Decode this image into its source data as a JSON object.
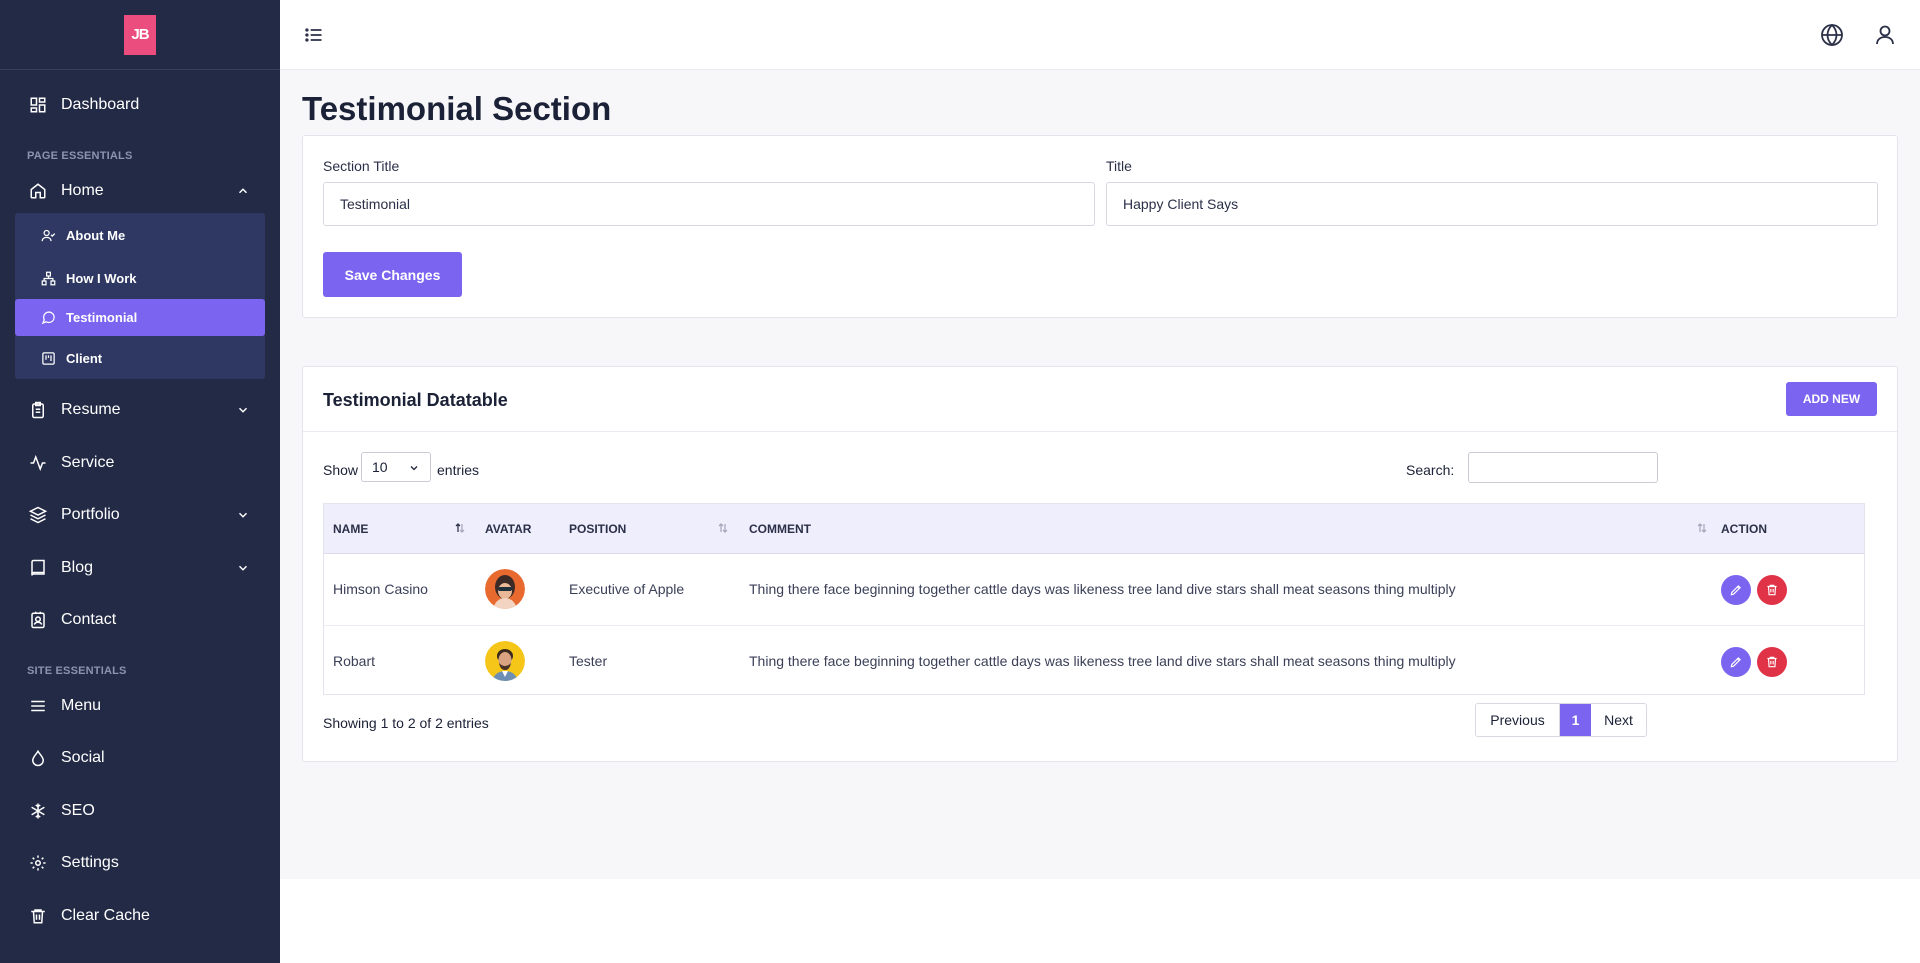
{
  "brand": {
    "logo_text": "JB",
    "logo_color": "#ec4d7f"
  },
  "sidebar": {
    "dashboard": "Dashboard",
    "section_page": "PAGE ESSENTIALS",
    "home": "Home",
    "home_sub": [
      "About Me",
      "How I Work",
      "Testimonial",
      "Client"
    ],
    "resume": "Resume",
    "service": "Service",
    "portfolio": "Portfolio",
    "blog": "Blog",
    "contact": "Contact",
    "section_site": "SITE ESSENTIALS",
    "menu": "Menu",
    "social": "Social",
    "seo": "SEO",
    "settings": "Settings",
    "clear_cache": "Clear Cache"
  },
  "page": {
    "title": "Testimonial Section"
  },
  "form": {
    "section_title_label": "Section Title",
    "section_title_value": "Testimonial",
    "title_label": "Title",
    "title_value": "Happy Client Says",
    "save_label": "Save Changes"
  },
  "datatable": {
    "title": "Testimonial Datatable",
    "add_label": "ADD NEW",
    "show_label": "Show",
    "page_length": "10",
    "entries_label": "entries",
    "search_label": "Search:",
    "columns": [
      "NAME",
      "AVATAR",
      "POSITION",
      "COMMENT",
      "ACTION"
    ],
    "rows": [
      {
        "name": "Himson Casino",
        "position": "Executive of Apple",
        "comment": "Thing there face beginning together cattle days was likeness tree land dive stars shall meat seasons thing multiply"
      },
      {
        "name": "Robart",
        "position": "Tester",
        "comment": "Thing there face beginning together cattle days was likeness tree land dive stars shall meat seasons thing multiply"
      }
    ],
    "info": "Showing 1 to 2 of 2 entries",
    "pagination": {
      "prev": "Previous",
      "current": "1",
      "next": "Next"
    }
  },
  "colors": {
    "sidebar_bg": "#232a45",
    "accent": "#7b64f0",
    "danger": "#e03348"
  }
}
